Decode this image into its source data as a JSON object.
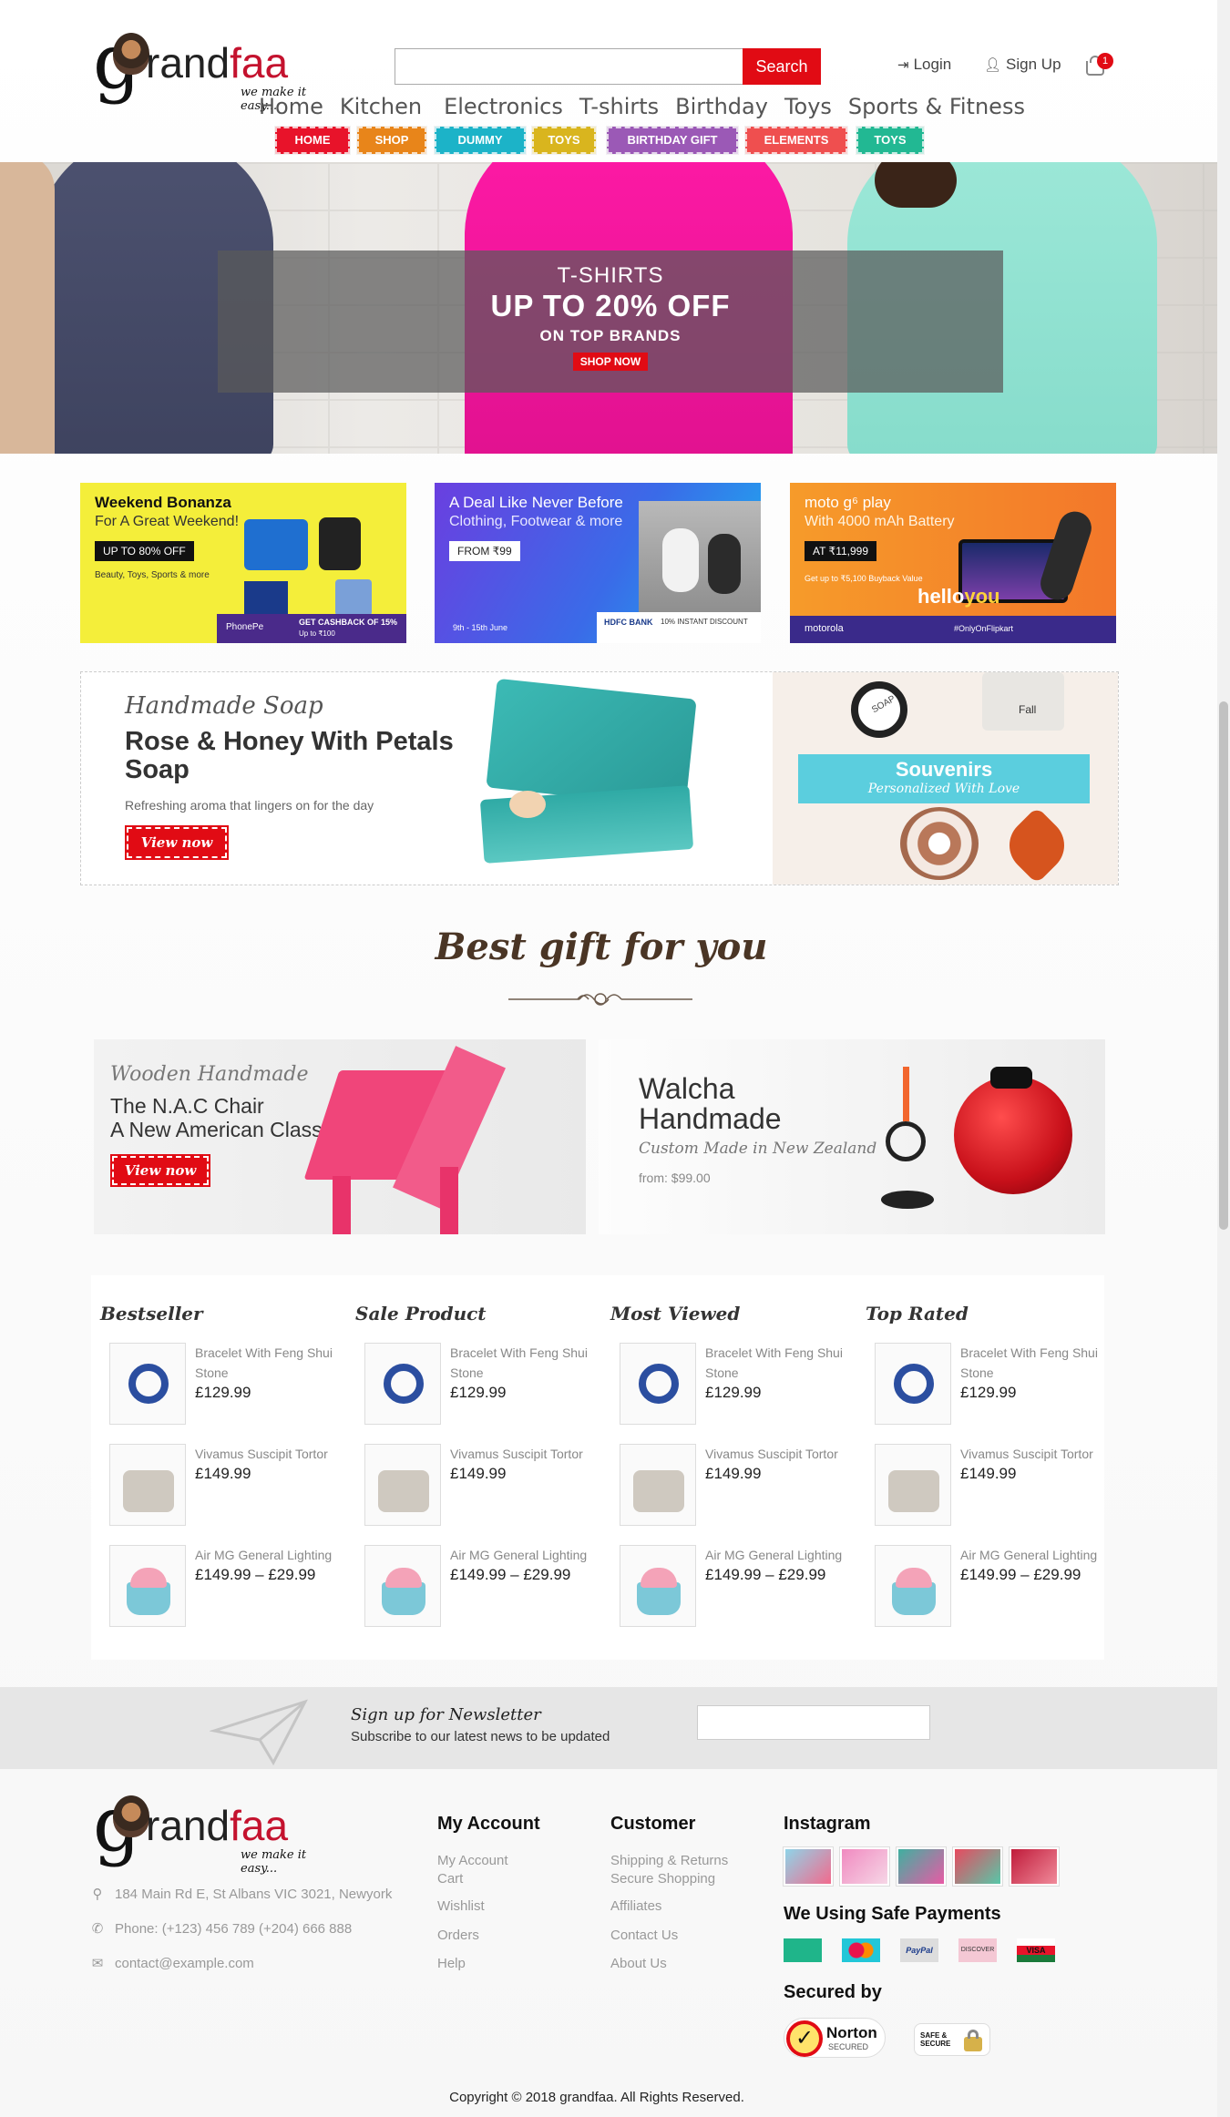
{
  "header": {
    "logo": {
      "g": "g",
      "rest": "rand",
      "accent": "faa",
      "tagline": "we make it easy..."
    },
    "search": {
      "placeholder": "",
      "button": "Search"
    },
    "links": {
      "login": "Login",
      "signup": "Sign Up",
      "cart_count": "1"
    },
    "nav": [
      "Home",
      "Kitchen",
      "Electronics",
      "T-shirts",
      "Birthday",
      "Toys",
      "Sports & Fitness"
    ],
    "tags": [
      {
        "label": "HOME",
        "color": "#e8132a"
      },
      {
        "label": "SHOP",
        "color": "#e8851a"
      },
      {
        "label": "DUMMY",
        "color": "#1cb3c8"
      },
      {
        "label": "TOYS",
        "color": "#d9b51e"
      },
      {
        "label": "BIRTHDAY GIFT",
        "color": "#9b59b6"
      },
      {
        "label": "ELEMENTS",
        "color": "#ef4f4f"
      },
      {
        "label": "TOYS",
        "color": "#22b893"
      }
    ]
  },
  "hero": {
    "category": "T-SHIRTS",
    "headline": "UP TO 20% OFF",
    "sub": "ON TOP BRANDS",
    "cta": "SHOP NOW"
  },
  "promos": [
    {
      "title": "Weekend Bonanza",
      "subtitle": "For A Great Weekend!",
      "pill": "UP TO 80% OFF",
      "note": "Beauty, Toys, Sports  & more",
      "footer": "GET CASHBACK OF 15%",
      "footer2": "Up to ₹100",
      "brand": "PhonePe"
    },
    {
      "title": "A Deal Like Never Before",
      "subtitle": "Clothing, Footwear & more",
      "pill": "FROM ₹99",
      "note": "9th - 15th June",
      "footer": "10% INSTANT DISCOUNT",
      "brand": "HDFC BANK"
    },
    {
      "title": "moto g⁶ play",
      "subtitle": "With 4000 mAh Battery",
      "pill": "AT ₹11,999",
      "note": "Get up to ₹5,100 Buyback Value",
      "hello": "hello",
      "you": "you",
      "brand": "motorola",
      "hashtag": "#OnlyOnFlipkart"
    }
  ],
  "soap": {
    "script": "Handmade Soap",
    "title1": "Rose & Honey With Petals",
    "title2": "Soap",
    "desc": "Refreshing aroma that lingers on for the day",
    "cta": "View now",
    "souvenir_title": "Souvenirs",
    "souvenir_sub": "Personalized With Love",
    "tag_soap": "SOAP",
    "tag_fall": "Fall"
  },
  "best_gift": {
    "title": "Best gift for you"
  },
  "chair": {
    "script": "Wooden Handmade",
    "line1": "The N.A.C Chair",
    "line2": "A New American Classic",
    "cta": "View now"
  },
  "walcha": {
    "line1": "Walcha",
    "line2": "Handmade",
    "script": "Custom Made in New Zealand",
    "price": "from: $99.00"
  },
  "product_lists": [
    {
      "title": "Bestseller",
      "items": [
        {
          "name": "Bracelet With Feng Shui Stone",
          "price": "£129.99"
        },
        {
          "name": "Vivamus Suscipit Tortor",
          "price": "£149.99"
        },
        {
          "name": "Air MG General Lighting",
          "price": "£149.99 – £29.99"
        }
      ]
    },
    {
      "title": "Sale Product",
      "items": [
        {
          "name": "Bracelet With Feng Shui Stone",
          "price": "£129.99"
        },
        {
          "name": "Vivamus Suscipit Tortor",
          "price": "£149.99"
        },
        {
          "name": "Air MG General Lighting",
          "price": "£149.99 – £29.99"
        }
      ]
    },
    {
      "title": "Most Viewed",
      "items": [
        {
          "name": "Bracelet With Feng Shui Stone",
          "price": "£129.99"
        },
        {
          "name": "Vivamus Suscipit Tortor",
          "price": "£149.99"
        },
        {
          "name": "Air MG General Lighting",
          "price": "£149.99 – £29.99"
        }
      ]
    },
    {
      "title": "Top Rated",
      "items": [
        {
          "name": "Bracelet With Feng Shui Stone",
          "price": "£129.99"
        },
        {
          "name": "Vivamus Suscipit Tortor",
          "price": "£149.99"
        },
        {
          "name": "Air MG General Lighting",
          "price": "£149.99 – £29.99"
        }
      ]
    }
  ],
  "newsletter": {
    "title": "Sign up for Newsletter",
    "sub": "Subscribe to our latest news to be updated",
    "placeholder": ""
  },
  "footer": {
    "address": "184 Main Rd E, St Albans VIC 3021, Newyork",
    "phone": "Phone: (+123) 456 789 (+204) 666 888",
    "email": "contact@example.com",
    "my_account": {
      "title": "My Account",
      "links": [
        "My Account",
        "Cart",
        "Wishlist",
        "Orders",
        "Help"
      ]
    },
    "customer": {
      "title": "Customer",
      "links": [
        "Shipping & Returns",
        "Secure Shopping",
        "Affiliates",
        "Contact Us",
        "About Us"
      ]
    },
    "instagram": {
      "title": "Instagram"
    },
    "payments": {
      "title": "We Using Safe Payments",
      "cards": [
        "",
        "",
        "PayPal",
        "DISCOVER",
        "VISA"
      ]
    },
    "secured": {
      "title": "Secured by",
      "norton": "Norton",
      "norton_sub": "SECURED",
      "safe": "SAFE & SECURE"
    },
    "copyright": "Copyright © 2018 grandfaa. All Rights Reserved."
  }
}
